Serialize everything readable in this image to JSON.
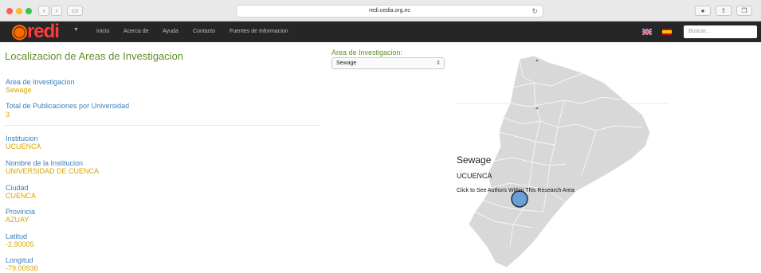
{
  "browser": {
    "url": "redi.cedia.org.ec",
    "traffic_colors": [
      "#fc5f57",
      "#fdbc2e",
      "#33c748"
    ]
  },
  "navbar": {
    "logo": "redi",
    "menu": [
      "Inicio",
      "Acerca de",
      "Ayuda",
      "Contacto",
      "Fuentes de Informacion"
    ],
    "search_placeholder": "Buscar..."
  },
  "page": {
    "title": "Localizacion de Areas de Investigacion",
    "accent": "#5f8f25"
  },
  "details": {
    "area_label": "Area de Investigacion",
    "area_value": "Sewage",
    "total_label": "Total de Publicaciones por Universidad",
    "total_value": "3",
    "inst_label": "Institucion",
    "inst_value": "UCUENCA",
    "name_label": "Nombre de la Institucion",
    "name_value": "UNIVERSIDAD DE CUENCA",
    "city_label": "Ciudad",
    "city_value": "CUENCA",
    "prov_label": "Provincia",
    "prov_value": "AZUAY",
    "lat_label": "Latitud",
    "lat_value": "-2.90005",
    "lon_label": "Longitud",
    "lon_value": "-79.00936"
  },
  "area_select": {
    "label": "Area de Investigacion:",
    "selected": "Sewage"
  },
  "map": {
    "popup_title": "Sewage",
    "popup_institution": "UCUENCA",
    "popup_link": "Click to See Authors Within This Research Area",
    "land_color": "#d8d8d8",
    "marker_color": "#6a9fd4"
  }
}
